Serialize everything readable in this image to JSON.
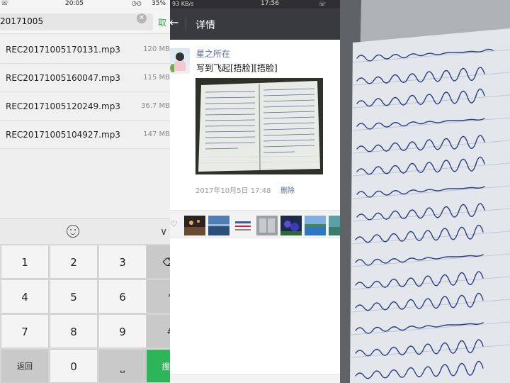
{
  "left_panel": {
    "status_bar": {
      "time": "20:05",
      "battery": "35%"
    },
    "search": {
      "query": "20171005",
      "cancel_label": "取"
    },
    "files": [
      {
        "name": "REC20171005170131.mp3",
        "size": "120 MB"
      },
      {
        "name": "REC20171005160047.mp3",
        "size": "115 MB"
      },
      {
        "name": "REC20171005120249.mp3",
        "size": "36.7 MB"
      },
      {
        "name": "REC20171005104927.mp3",
        "size": "147 MB"
      }
    ],
    "keyboard": {
      "keys": [
        "1",
        "2",
        "3",
        "4",
        "5",
        "6",
        "7",
        "8",
        "9",
        "0"
      ],
      "back_label": "返回",
      "search_label": "搜索",
      "star": "*",
      "hash": "#"
    }
  },
  "middle_panel": {
    "status_bar": {
      "network": "93 KB/s",
      "time": "17:56"
    },
    "header": {
      "title": "详情"
    },
    "post": {
      "author": "星之所在",
      "text": "写到飞起[捂脸][捂脸]",
      "time": "2017年10月5日 17:48",
      "delete_label": "删除"
    }
  },
  "colors": {
    "accent_green": "#2db55a",
    "link_blue": "#576b95",
    "titlebar_dark": "#393a3f"
  }
}
